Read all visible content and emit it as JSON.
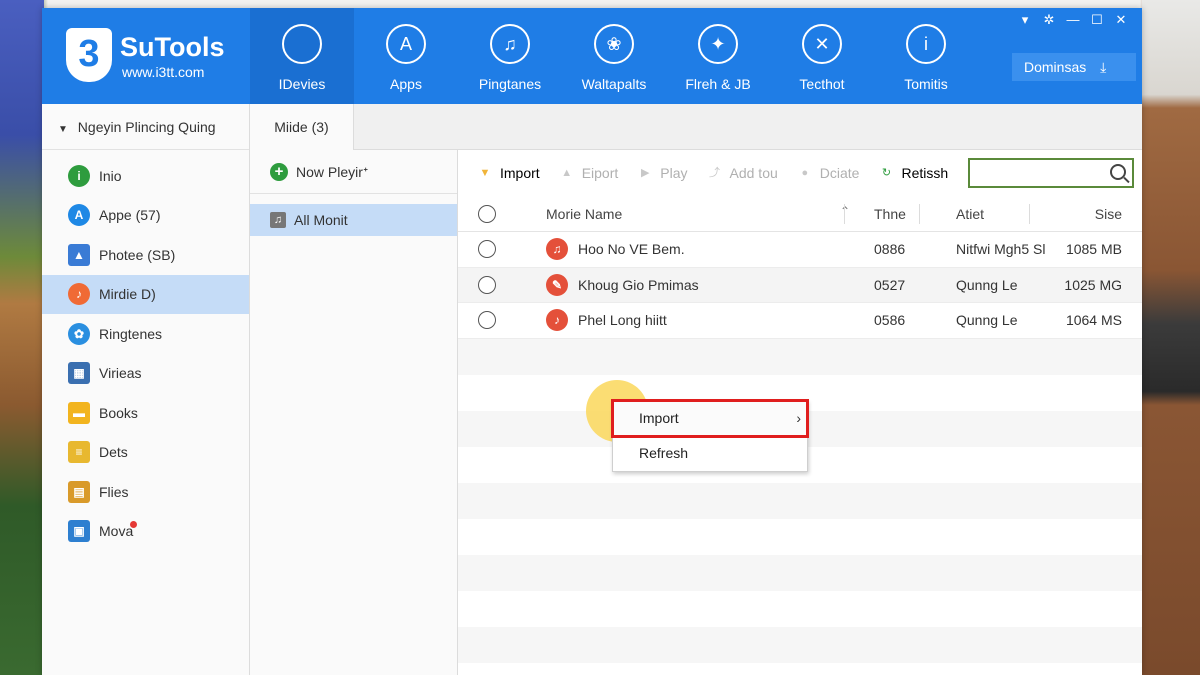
{
  "app": {
    "logo_number": "3",
    "logo_title": "SuTools",
    "logo_subtitle": "www.i3tt.com"
  },
  "nav": [
    {
      "label": "IDevies",
      "icon": "apple-icon",
      "glyph": ""
    },
    {
      "label": "Apps",
      "icon": "apps-icon",
      "glyph": "A"
    },
    {
      "label": "Pingtanes",
      "icon": "bell-icon",
      "glyph": "♫"
    },
    {
      "label": "Waltapalts",
      "icon": "wallpaper-icon",
      "glyph": "❀"
    },
    {
      "label": "Flreh & JB",
      "icon": "flash-icon",
      "glyph": "✦"
    },
    {
      "label": "Tecthot",
      "icon": "toolbox-icon",
      "glyph": "✕"
    },
    {
      "label": "Tomitis",
      "icon": "info-icon",
      "glyph": "i"
    }
  ],
  "window_controls": [
    "▾",
    "✲",
    "—",
    "☐",
    "✕"
  ],
  "download_button": {
    "label": "Dominsas",
    "icon": "download-icon"
  },
  "device": {
    "name": "Ngeyin Plincing Quing"
  },
  "sidebar": [
    {
      "label": "Inio",
      "icon": "info-icon",
      "color": "#2e9c3e",
      "glyph": "i"
    },
    {
      "label": "Appe (57)",
      "icon": "appstore-icon",
      "color": "#1e88e5",
      "glyph": "A"
    },
    {
      "label": "Photee (SB)",
      "icon": "photo-icon",
      "color": "#3a7bd5",
      "glyph": "▲"
    },
    {
      "label": "Mirdie D)",
      "icon": "music-icon",
      "color": "#f06a35",
      "glyph": "♪"
    },
    {
      "label": "Ringtenes",
      "icon": "ringtone-icon",
      "color": "#2a8fe0",
      "glyph": "✿"
    },
    {
      "label": "Virieas",
      "icon": "video-icon",
      "color": "#3a6fb0",
      "glyph": "▦"
    },
    {
      "label": "Books",
      "icon": "books-icon",
      "color": "#f2b41e",
      "glyph": "▬"
    },
    {
      "label": "Dets",
      "icon": "data-icon",
      "color": "#e8b830",
      "glyph": "≡"
    },
    {
      "label": "Flies",
      "icon": "files-icon",
      "color": "#d99a2a",
      "glyph": "▤"
    },
    {
      "label": "Mova",
      "icon": "more-icon",
      "color": "#2d7fd0",
      "glyph": "▣"
    }
  ],
  "active_sidebar_index": 3,
  "mid_tab": {
    "label": "Miide (3)"
  },
  "playlist": {
    "new_label": "Now Pleyirᐩ",
    "items": [
      {
        "label": "All Monit"
      }
    ]
  },
  "toolbar": [
    {
      "label": "Import",
      "icon": "import-icon",
      "disabled": false,
      "color": "#f0b43a",
      "glyph": "▼"
    },
    {
      "label": "Eiport",
      "icon": "export-icon",
      "disabled": true,
      "color": "#c8c8c8",
      "glyph": "▲"
    },
    {
      "label": "Play",
      "icon": "play-icon",
      "disabled": true,
      "color": "#c8c8c8",
      "glyph": "▶"
    },
    {
      "label": "Add tou",
      "icon": "add-to-icon",
      "disabled": true,
      "color": "#c8c8c8",
      "glyph": "⤴"
    },
    {
      "label": "Dciate",
      "icon": "delete-icon",
      "disabled": true,
      "color": "#c8c8c8",
      "glyph": "●"
    },
    {
      "label": "Retissh",
      "icon": "refresh-icon",
      "disabled": false,
      "color": "#2e9c3e",
      "glyph": "↻"
    }
  ],
  "search": {
    "placeholder": ""
  },
  "table": {
    "columns": [
      "Morie Name",
      "Thne",
      "Atiet",
      "Sise"
    ],
    "rows": [
      {
        "name": "Hoo No VE Bem.",
        "time": "0886",
        "artist": "Nitfwi Mgh5 Sl",
        "size": "1085 MB"
      },
      {
        "name": "Khoug Gio Pmimas",
        "time": "0527",
        "artist": "Qunng Le",
        "size": "1025 MG"
      },
      {
        "name": "Phel Long hiitt",
        "time": "0586",
        "artist": "Qunng Le",
        "size": "1064 MS"
      }
    ]
  },
  "context_menu": [
    {
      "label": "Import",
      "has_submenu": true,
      "highlighted": true
    },
    {
      "label": "Refresh",
      "has_submenu": false,
      "highlighted": false
    }
  ]
}
